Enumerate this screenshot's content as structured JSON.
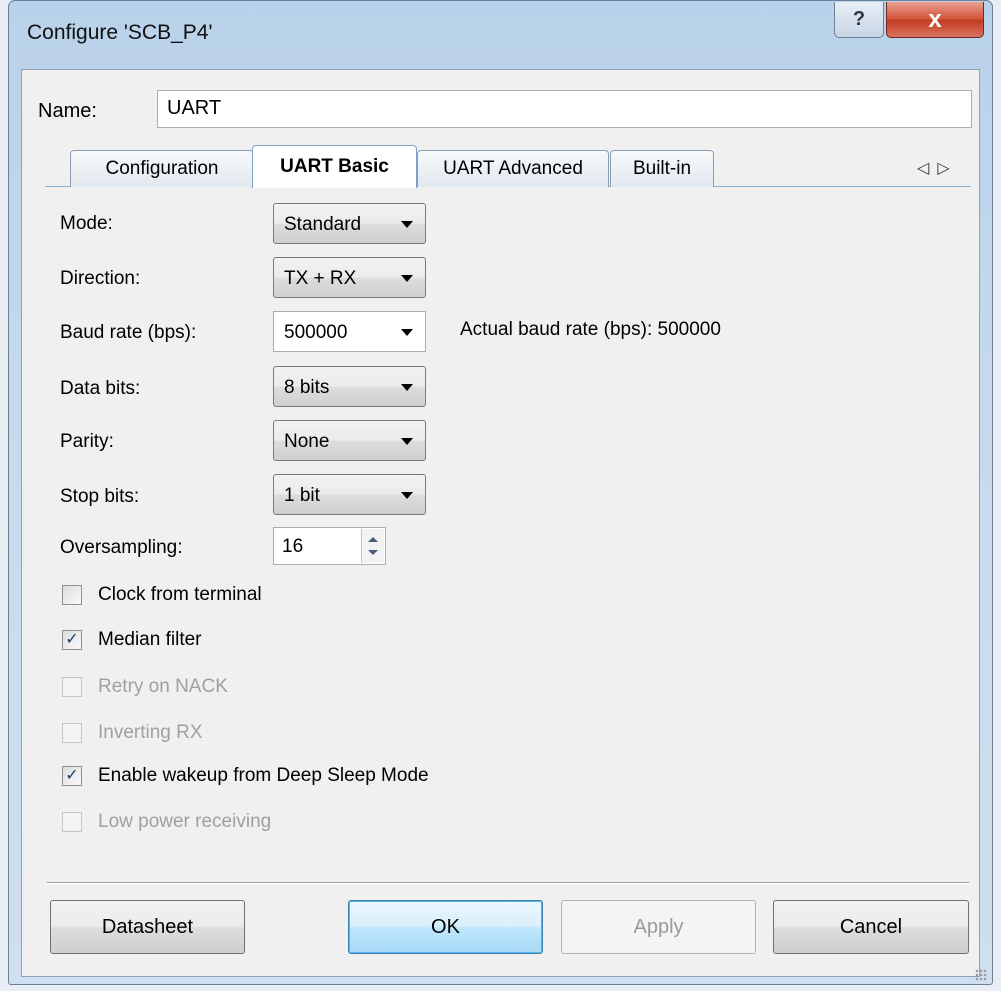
{
  "window": {
    "title": "Configure 'SCB_P4'",
    "help_symbol": "?",
    "close_symbol": "x"
  },
  "name": {
    "label": "Name:",
    "value": "UART"
  },
  "tabs": [
    {
      "label": "Configuration",
      "active": false
    },
    {
      "label": "UART Basic",
      "active": true
    },
    {
      "label": "UART Advanced",
      "active": false
    },
    {
      "label": "Built-in",
      "active": false
    }
  ],
  "tab_scroll": {
    "left": "◁",
    "right": "▷"
  },
  "fields": {
    "mode": {
      "label": "Mode:",
      "value": "Standard"
    },
    "direction": {
      "label": "Direction:",
      "value": "TX + RX"
    },
    "baud": {
      "label": "Baud rate (bps):",
      "value": "500000",
      "actual": "Actual baud rate (bps): 500000"
    },
    "data_bits": {
      "label": "Data bits:",
      "value": "8 bits"
    },
    "parity": {
      "label": "Parity:",
      "value": "None"
    },
    "stop_bits": {
      "label": "Stop bits:",
      "value": "1 bit"
    },
    "oversampling": {
      "label": "Oversampling:",
      "value": "16"
    }
  },
  "checkboxes": [
    {
      "label": "Clock from terminal",
      "checked": false,
      "enabled": true
    },
    {
      "label": "Median filter",
      "checked": true,
      "enabled": true
    },
    {
      "label": "Retry on NACK",
      "checked": false,
      "enabled": false
    },
    {
      "label": "Inverting RX",
      "checked": false,
      "enabled": false
    },
    {
      "label": "Enable wakeup from Deep Sleep Mode",
      "checked": true,
      "enabled": true
    },
    {
      "label": "Low power receiving",
      "checked": false,
      "enabled": false
    }
  ],
  "check_mark": "✓",
  "buttons": {
    "datasheet": "Datasheet",
    "ok": "OK",
    "apply": "Apply",
    "cancel": "Cancel"
  }
}
